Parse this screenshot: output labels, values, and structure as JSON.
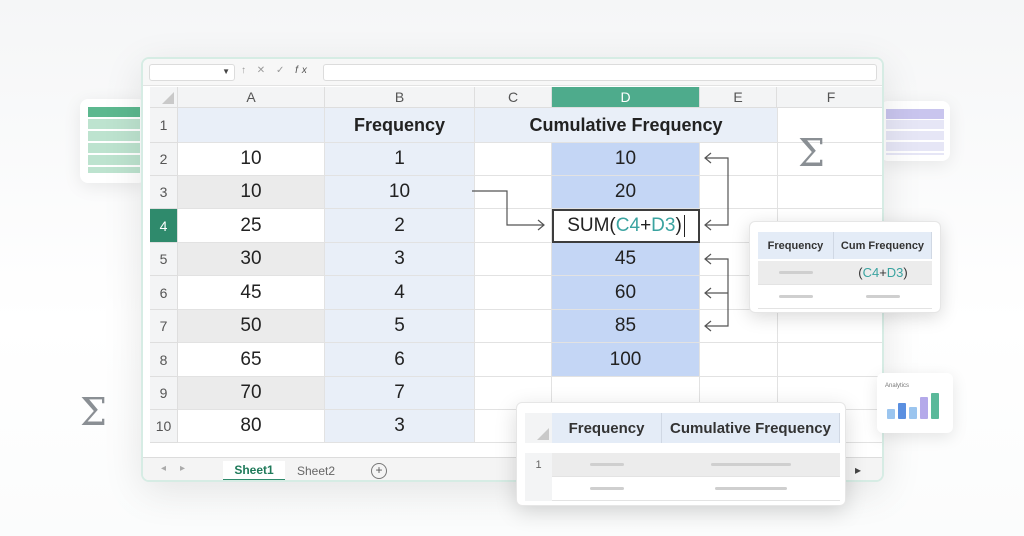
{
  "spreadsheet": {
    "column_headers": [
      "A",
      "B",
      "C",
      "D",
      "E",
      "F"
    ],
    "row_headers": [
      "1",
      "2",
      "3",
      "4",
      "5",
      "6",
      "7",
      "8",
      "9",
      "10"
    ],
    "header_row": {
      "b": "Frequency",
      "cd": "Cumulative Frequency"
    },
    "column_a": [
      "10",
      "10",
      "25",
      "30",
      "45",
      "50",
      "65",
      "70",
      "80"
    ],
    "column_b": [
      "1",
      "10",
      "2",
      "3",
      "4",
      "5",
      "6",
      "7",
      "3"
    ],
    "column_d": [
      "10",
      "20",
      "",
      "45",
      "60",
      "85",
      "100"
    ],
    "active_cell": {
      "prefix": "SUM(",
      "ref1": "C4",
      "op": "+",
      "ref2": "D3",
      "suffix": ")"
    },
    "formula_bar": {
      "fx_label": "fx",
      "icons": [
        "↑",
        "✕",
        "✓"
      ]
    },
    "sheet_tabs": [
      "Sheet1",
      "Sheet2"
    ],
    "add_tab_symbol": "+",
    "active_tab": "Sheet1",
    "accent_color": "#4eab8c"
  },
  "popup_right": {
    "headers": [
      "Frequency",
      "Cum Frequency"
    ],
    "formula": "(C4+D3)"
  },
  "popup_bottom": {
    "headers": [
      "Frequency",
      "Cumulative Frequency"
    ],
    "rows": [
      "1",
      ""
    ]
  },
  "analytics_card": {
    "label": "Analytics"
  },
  "decor": {
    "sigma": "Σ",
    "scroll_arrow": "▸"
  }
}
